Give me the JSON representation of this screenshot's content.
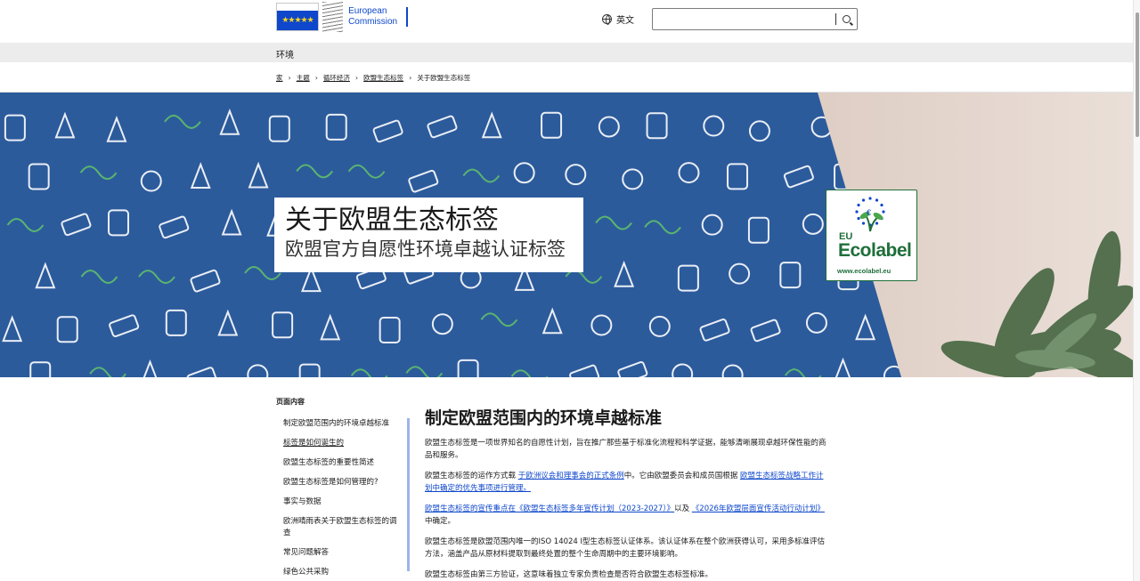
{
  "header": {
    "logo_line1": "European",
    "logo_line2": "Commission",
    "language": "英文",
    "search_value": ""
  },
  "site_name": "环境",
  "breadcrumb": [
    "家",
    "主题",
    "循环经济",
    "欧盟生态标签",
    "关于欧盟生态标签"
  ],
  "hero": {
    "title": "关于欧盟生态标签",
    "subtitle": "欧盟官方自愿性环境卓越认证标签",
    "ecolabel_eu": "EU",
    "ecolabel_name": "Ecolabel",
    "ecolabel_url": "www.ecolabel.eu"
  },
  "toc": {
    "heading": "页面内容",
    "items": [
      "制定欧盟范围内的环境卓越标准",
      "标签是如何诞生的",
      "欧盟生态标签的重要性简述",
      "欧盟生态标签是如何管理的?",
      "事实与数据",
      "欧洲晴雨表关于欧盟生态标签的调查",
      "常见问题解答",
      "绿色公共采购"
    ],
    "active_index": 1
  },
  "main": {
    "heading": "制定欧盟范围内的环境卓越标准",
    "p1": "欧盟生态标签是一项世界知名的自愿性计划，旨在推广那些基于标准化流程和科学证据，能够清晰展现卓越环保性能的商品和服务。",
    "p2_a": "欧盟生态标签的运作方式载 ",
    "p2_link1": "于欧洲议会和理事会的正式条例",
    "p2_b": "中。它由欧盟委员会和成员国根据 ",
    "p2_link2": "欧盟生态标签战略工作计划中确定的优先事项进行管理。",
    "p3_link1": "欧盟生态标签的宣传重点在《欧盟生态标签多年宣传计划（2023-2027）》",
    "p3_a": "以及 ",
    "p3_link2": "《2026年欧盟层面宣传活动行动计划》",
    "p3_b": "中确定。",
    "p4": "欧盟生态标签是欧盟范围内唯一的ISO 14024 I型生态标签认证体系。该认证体系在整个欧洲获得认可，采用多标准评估方法，涵盖产品从原材料提取到最终处置的整个生命周期中的主要环境影响。",
    "p5": "欧盟生态标签由第三方验证，这意味着独立专家负责检查是否符合欧盟生态标签标准。"
  },
  "colors": {
    "hero_blue": "#2c5b9c",
    "link_blue": "#0e47cb",
    "eco_green": "#1f6f3a"
  }
}
